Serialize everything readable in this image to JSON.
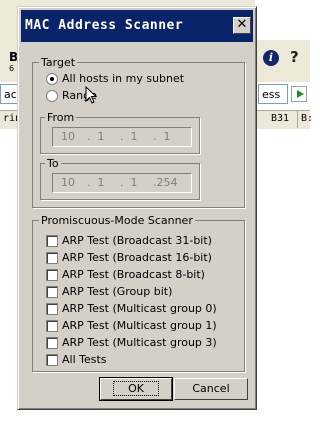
{
  "background": {
    "toolbar_letter": "B",
    "toolbar_sub": "6",
    "tabs": [
      "acke",
      "ess"
    ],
    "columns": [
      "rint",
      "B31",
      "B:"
    ],
    "help_glyph": "i",
    "question_glyph": "?"
  },
  "dialog": {
    "title": "MAC Address Scanner",
    "close_glyph": "✕",
    "target": {
      "legend": "Target",
      "options": [
        {
          "label": "All hosts in my subnet",
          "selected": true
        },
        {
          "label": "Range",
          "selected": false
        }
      ],
      "from": {
        "legend": "From",
        "ip": [
          "10",
          "1",
          "1",
          "1"
        ]
      },
      "to": {
        "legend": "To",
        "ip": [
          "10",
          "1",
          "1",
          "254"
        ]
      }
    },
    "promiscuous": {
      "legend": "Promiscuous-Mode Scanner",
      "tests": [
        {
          "label": "ARP Test (Broadcast 31-bit)",
          "checked": false
        },
        {
          "label": "ARP Test (Broadcast 16-bit)",
          "checked": false
        },
        {
          "label": "ARP Test (Broadcast 8-bit)",
          "checked": false
        },
        {
          "label": "ARP Test (Group bit)",
          "checked": false
        },
        {
          "label": "ARP Test (Multicast group 0)",
          "checked": false
        },
        {
          "label": "ARP Test (Multicast group 1)",
          "checked": false
        },
        {
          "label": "ARP Test (Multicast group 3)",
          "checked": false
        },
        {
          "label": "All Tests",
          "checked": false
        }
      ]
    },
    "buttons": {
      "ok": "OK",
      "cancel": "Cancel"
    }
  },
  "colors": {
    "titlebar": "#0a246a",
    "face": "#d4d0c8"
  }
}
